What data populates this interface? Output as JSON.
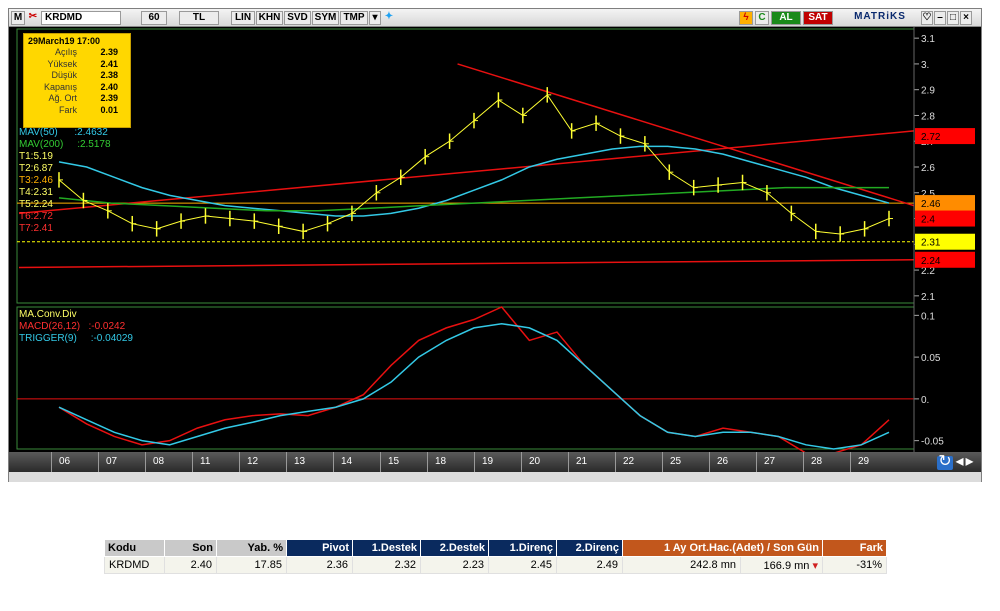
{
  "toolbar": {
    "m_label": "M",
    "symbol": "KRDMD",
    "interval": "60",
    "currency": "TL",
    "buttons": [
      "LIN",
      "KHN",
      "SVD",
      "SYM",
      "TMP"
    ],
    "c_label": "C",
    "buy_label": "AL",
    "sell_label": "SAT",
    "brand": "MATRiKS"
  },
  "info_box": {
    "datetime": "29March19 17:00",
    "rows": [
      {
        "label": "Açılış",
        "value": "2.39"
      },
      {
        "label": "Yüksek",
        "value": "2.41"
      },
      {
        "label": "Düşük",
        "value": "2.38"
      },
      {
        "label": "Kapanış",
        "value": "2.40"
      },
      {
        "label": "Ağ. Ort",
        "value": "2.39"
      },
      {
        "label": "Fark",
        "value": "0.01"
      }
    ]
  },
  "legends": {
    "mav50": "MAV(50)",
    "mav50_val": ":2.4632",
    "mav200": "MAV(200)",
    "mav200_val": ":2.5178",
    "t1": "T1:5.19",
    "t2": "T2:6.87",
    "t3": "T3:2.46",
    "t4": "T4:2.31",
    "t5": "T5:2.24",
    "t6": "T6:2.72",
    "t7": "T7:2.41",
    "macd_title": "MA.Conv.Div",
    "macd": "MACD(26,12)",
    "macd_val": ":-0.0242",
    "trigger": "TRIGGER(9)",
    "trigger_val": ":-0.04029"
  },
  "colors": {
    "price": "#ffff33",
    "mav50": "#33c9e6",
    "mav200": "#22aa22",
    "trend_red": "#e81010",
    "level_orange": "#ffb000",
    "macd_red": "#e81010",
    "trigger_cyan": "#33c9e6",
    "tag_red": "#ff0000",
    "tag_orange": "#ff8c00",
    "tag_yellow": "#ffff00"
  },
  "chart_data": [
    {
      "type": "line",
      "title": "KRDMD",
      "xlabel": "",
      "ylabel": "",
      "categories": [
        "06",
        "07",
        "08",
        "11",
        "12",
        "13",
        "14",
        "15",
        "18",
        "19",
        "20",
        "21",
        "22",
        "25",
        "26",
        "27",
        "28",
        "29"
      ],
      "ylim": [
        2.08,
        3.12
      ],
      "y_ticks": [
        "3.1",
        "3.",
        "2.9",
        "2.8",
        "2.7",
        "2.6",
        "2.5",
        "2.4",
        "2.3",
        "2.2",
        "2.1"
      ],
      "price_tags": [
        "2.72",
        "2.46",
        "2.4",
        "2.31",
        "2.24"
      ],
      "series": [
        {
          "name": "price",
          "values": [
            2.55,
            2.47,
            2.43,
            2.38,
            2.36,
            2.39,
            2.41,
            2.4,
            2.39,
            2.37,
            2.35,
            2.38,
            2.42,
            2.5,
            2.56,
            2.64,
            2.7,
            2.78,
            2.86,
            2.8,
            2.88,
            2.74,
            2.77,
            2.72,
            2.69,
            2.58,
            2.52,
            2.53,
            2.54,
            2.5,
            2.42,
            2.35,
            2.34,
            2.36,
            2.4
          ]
        },
        {
          "name": "MAV(50)",
          "values": [
            2.62,
            2.6,
            2.56,
            2.52,
            2.49,
            2.47,
            2.45,
            2.44,
            2.43,
            2.42,
            2.41,
            2.41,
            2.42,
            2.44,
            2.47,
            2.51,
            2.55,
            2.6,
            2.63,
            2.65,
            2.67,
            2.68,
            2.68,
            2.67,
            2.65,
            2.62,
            2.59,
            2.56,
            2.52,
            2.49,
            2.46
          ]
        },
        {
          "name": "MAV(200)",
          "values": [
            2.48,
            2.46,
            2.45,
            2.44,
            2.43,
            2.43,
            2.44,
            2.45,
            2.46,
            2.47,
            2.48,
            2.49,
            2.5,
            2.51,
            2.52,
            2.52,
            2.52
          ]
        },
        {
          "name": "T2",
          "x0": 0,
          "y0": 2.42,
          "x1": 1,
          "y1": 2.74
        },
        {
          "name": "T6",
          "x0": 0.49,
          "y0": 3.0,
          "x1": 1,
          "y1": 2.45
        },
        {
          "name": "T5",
          "x0": 0,
          "y0": 2.21,
          "x1": 1,
          "y1": 2.24
        }
      ]
    },
    {
      "type": "line",
      "title": "MA.Conv.Div",
      "ylim": [
        -0.06,
        0.11
      ],
      "y_ticks": [
        "0.1",
        "0.05",
        "0.",
        "-0.05"
      ],
      "series": [
        {
          "name": "MACD(26,12)",
          "values": [
            -0.01,
            -0.03,
            -0.045,
            -0.055,
            -0.05,
            -0.035,
            -0.025,
            -0.02,
            -0.018,
            -0.02,
            -0.01,
            0.005,
            0.04,
            0.07,
            0.085,
            0.095,
            0.11,
            0.07,
            0.08,
            0.04,
            0.01,
            -0.02,
            -0.04,
            -0.045,
            -0.035,
            -0.04,
            -0.045,
            -0.065,
            -0.065,
            -0.055,
            -0.025
          ]
        },
        {
          "name": "TRIGGER(9)",
          "values": [
            -0.01,
            -0.025,
            -0.04,
            -0.05,
            -0.055,
            -0.045,
            -0.035,
            -0.028,
            -0.02,
            -0.015,
            -0.01,
            0.0,
            0.02,
            0.05,
            0.07,
            0.085,
            0.09,
            0.085,
            0.07,
            0.04,
            0.01,
            -0.02,
            -0.04,
            -0.045,
            -0.04,
            -0.04,
            -0.045,
            -0.055,
            -0.06,
            -0.055,
            -0.04
          ]
        }
      ]
    }
  ],
  "table": {
    "headers": [
      "Kodu",
      "Son",
      "Yab. %",
      "Pivot",
      "1.Destek",
      "2.Destek",
      "1.Direnç",
      "2.Direnç",
      "1 Ay Ort.Hac.(Adet)  /  Son Gün",
      "",
      "Fark"
    ],
    "row": [
      "KRDMD",
      "2.40",
      "17.85",
      "2.36",
      "2.32",
      "2.23",
      "2.45",
      "2.49",
      "242.8 mn",
      "166.9 mn",
      "-31%"
    ]
  }
}
